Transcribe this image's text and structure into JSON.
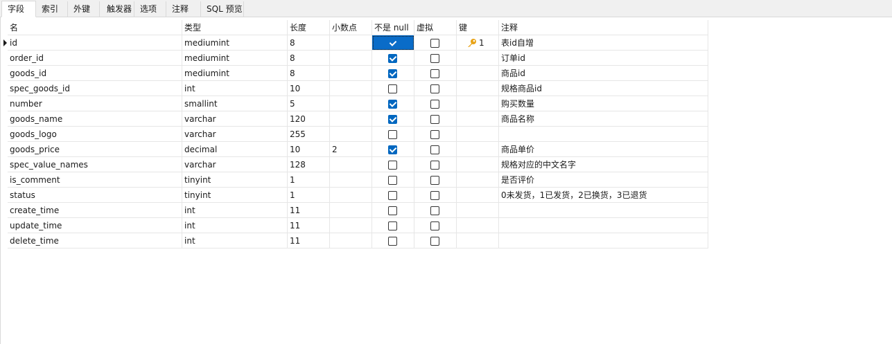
{
  "tabs": [
    "字段",
    "索引",
    "外键",
    "触发器",
    "选项",
    "注释",
    "SQL 预览"
  ],
  "active_tab": 0,
  "columns": [
    "名",
    "类型",
    "长度",
    "小数点",
    "不是 null",
    "虚拟",
    "键",
    "注释"
  ],
  "rows": [
    {
      "name": "id",
      "type": "mediumint",
      "length": "8",
      "decimals": "",
      "not_null": true,
      "virtual": false,
      "key": "1",
      "comment": "表id自增"
    },
    {
      "name": "order_id",
      "type": "mediumint",
      "length": "8",
      "decimals": "",
      "not_null": true,
      "virtual": false,
      "key": "",
      "comment": "订单id"
    },
    {
      "name": "goods_id",
      "type": "mediumint",
      "length": "8",
      "decimals": "",
      "not_null": true,
      "virtual": false,
      "key": "",
      "comment": "商品id"
    },
    {
      "name": "spec_goods_id",
      "type": "int",
      "length": "10",
      "decimals": "",
      "not_null": false,
      "virtual": false,
      "key": "",
      "comment": "规格商品id"
    },
    {
      "name": "number",
      "type": "smallint",
      "length": "5",
      "decimals": "",
      "not_null": true,
      "virtual": false,
      "key": "",
      "comment": "购买数量"
    },
    {
      "name": "goods_name",
      "type": "varchar",
      "length": "120",
      "decimals": "",
      "not_null": true,
      "virtual": false,
      "key": "",
      "comment": "商品名称"
    },
    {
      "name": "goods_logo",
      "type": "varchar",
      "length": "255",
      "decimals": "",
      "not_null": false,
      "virtual": false,
      "key": "",
      "comment": ""
    },
    {
      "name": "goods_price",
      "type": "decimal",
      "length": "10",
      "decimals": "2",
      "not_null": true,
      "virtual": false,
      "key": "",
      "comment": "商品单价"
    },
    {
      "name": "spec_value_names",
      "type": "varchar",
      "length": "128",
      "decimals": "",
      "not_null": false,
      "virtual": false,
      "key": "",
      "comment": "规格对应的中文名字"
    },
    {
      "name": "is_comment",
      "type": "tinyint",
      "length": "1",
      "decimals": "",
      "not_null": false,
      "virtual": false,
      "key": "",
      "comment": "是否评价"
    },
    {
      "name": "status",
      "type": "tinyint",
      "length": "1",
      "decimals": "",
      "not_null": false,
      "virtual": false,
      "key": "",
      "comment": "0未发货，1已发货，2已换货，3已退货"
    },
    {
      "name": "create_time",
      "type": "int",
      "length": "11",
      "decimals": "",
      "not_null": false,
      "virtual": false,
      "key": "",
      "comment": ""
    },
    {
      "name": "update_time",
      "type": "int",
      "length": "11",
      "decimals": "",
      "not_null": false,
      "virtual": false,
      "key": "",
      "comment": ""
    },
    {
      "name": "delete_time",
      "type": "int",
      "length": "11",
      "decimals": "",
      "not_null": false,
      "virtual": false,
      "key": "",
      "comment": ""
    }
  ],
  "selected_row": 0,
  "selected_column": "not_null",
  "colors": {
    "accent": "#0067c0",
    "selection": "#0a6cc8",
    "key_icon": "#e8a317"
  },
  "icons": {
    "row_indicator": "row-indicator-arrow-icon",
    "key": "key-icon"
  }
}
